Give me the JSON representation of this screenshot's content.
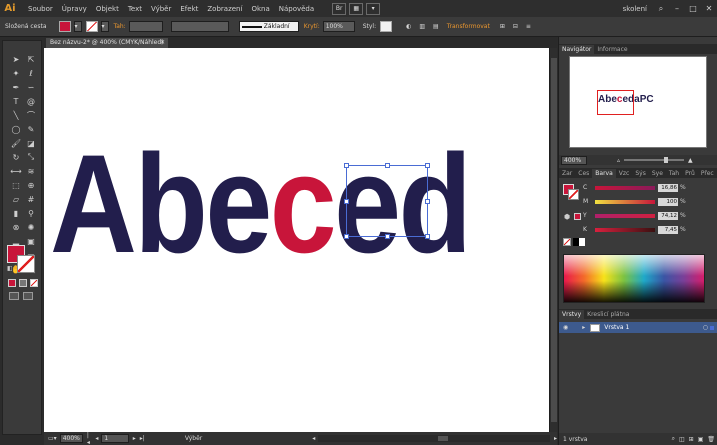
{
  "menubar": {
    "logo": "Ai",
    "items": [
      "Soubor",
      "Úpravy",
      "Objekt",
      "Text",
      "Výběr",
      "Efekt",
      "Zobrazení",
      "Okna",
      "Nápověda"
    ],
    "br_badge": "Br",
    "workspace": "skolení"
  },
  "controlbar": {
    "object_type": "Složená cesta",
    "stroke_label": "Tah:",
    "stroke_style": "Základní",
    "opacity_label": "Krytí:",
    "opacity_value": "100%",
    "style_label": "Styl:",
    "transform_label": "Transformovat",
    "fill_color": "#c8153a"
  },
  "document": {
    "tab_title": "Bez názvu-2* @ 400% (CMYK/Náhled)"
  },
  "artwork": {
    "before": "Abe",
    "highlight": "c",
    "after": "ed",
    "text_color": "#221e4c",
    "highlight_color": "#c8153a"
  },
  "statusbar": {
    "zoom": "400%",
    "page": "1",
    "tool": "Výběr"
  },
  "navigator": {
    "tab_navigator": "Navigátor",
    "tab_info": "Informace",
    "thumb_before": "Abe",
    "thumb_highlight": "c",
    "thumb_after": "edaPC",
    "zoom": "400%"
  },
  "color_panel": {
    "tabs": [
      "Zar",
      "Ces",
      "Barva",
      "Vzc",
      "Sýs",
      "Sye",
      "Tah",
      "Prů",
      "Přec"
    ],
    "active_tab": "Barva",
    "channels": [
      {
        "label": "C",
        "value": "16,86",
        "unit": "%"
      },
      {
        "label": "M",
        "value": "100",
        "unit": "%"
      },
      {
        "label": "Y",
        "value": "74,12",
        "unit": "%"
      },
      {
        "label": "K",
        "value": "7,45",
        "unit": "%"
      }
    ]
  },
  "layers_panel": {
    "tab_layers": "Vrstvy",
    "tab_artboards": "Kreslicí plátna",
    "layer_name": "Vrstva 1",
    "footer_count": "1 vrstva"
  }
}
